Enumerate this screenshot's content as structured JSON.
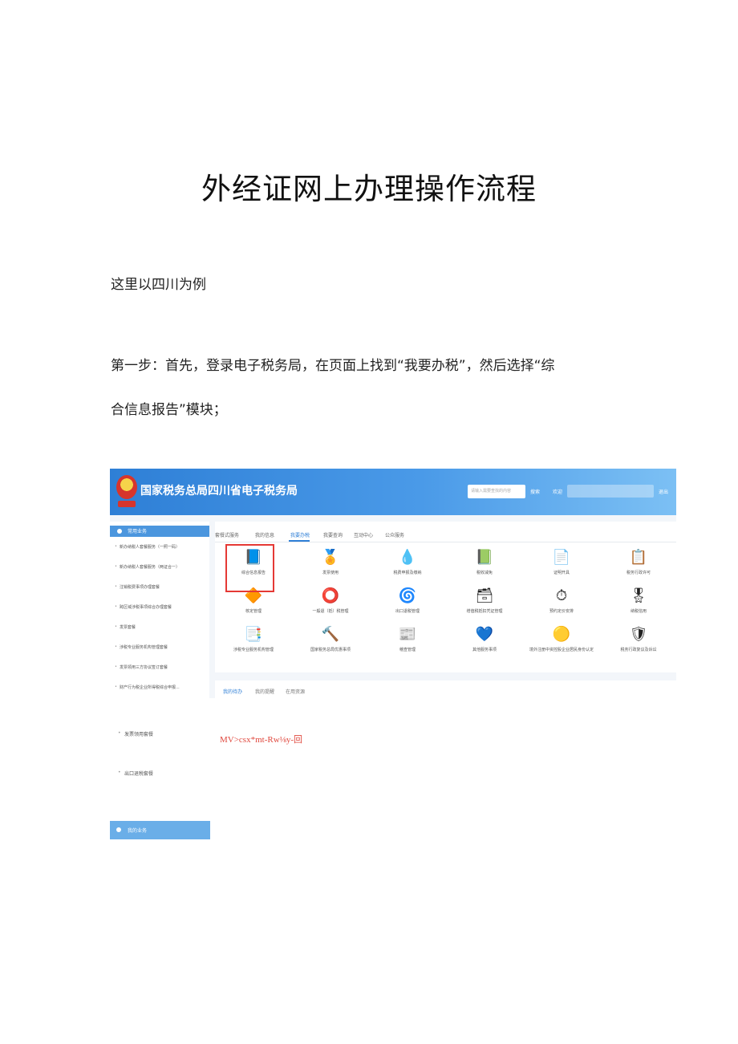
{
  "doc": {
    "title": "外经证网上办理操作流程",
    "intro": "这里以四川为例",
    "step1_line1": "第一步：首先，登录电子税务局，在页面上找到“我要办税”，然后选择“综",
    "step1_line2": "合信息报告”模块；"
  },
  "screenshot": {
    "site_title": "国家税务总局四川省电子税务局",
    "search_placeholder": "请输入需要查找的内容",
    "search_button": "搜索",
    "user_greeting": "欢迎",
    "logout": "退出",
    "sidebar_header": "常用业务",
    "sidebar_items": [
      "新办纳税人套餐服务（一照一码）",
      "新办纳税人套餐服务（两证合一）",
      "注销税费事项办理套餐",
      "跨区域涉税事项综合办理套餐",
      "发票套餐",
      "涉税专业服务机构管理套餐",
      "发票领用三方协议签订套餐",
      "财产行为税企业所得税综合申报..."
    ],
    "tabs": [
      "套餐式服务",
      "我的信息",
      "我要办税",
      "我要查询",
      "互动中心",
      "公众服务"
    ],
    "modules": [
      {
        "label": "综合信息报告",
        "icon": "📘"
      },
      {
        "label": "发票使用",
        "icon": "🏅"
      },
      {
        "label": "税费申报及缴纳",
        "icon": "💧"
      },
      {
        "label": "税收减免",
        "icon": "📗"
      },
      {
        "label": "证明开具",
        "icon": "📄"
      },
      {
        "label": "税务行政许可",
        "icon": "📋"
      },
      {
        "label": "核定管理",
        "icon": "🔶"
      },
      {
        "label": "一般退（抵）税管理",
        "icon": "⭕"
      },
      {
        "label": "出口退税管理",
        "icon": "🌀"
      },
      {
        "label": "增值税抵扣凭证管理",
        "icon": "🗃"
      },
      {
        "label": "预约定价安排",
        "icon": "⏱"
      },
      {
        "label": "纳税信用",
        "icon": "🎖"
      },
      {
        "label": "涉税专业服务机构管理",
        "icon": "📑"
      },
      {
        "label": "国家税务总局优惠事项",
        "icon": "🔨"
      },
      {
        "label": "稽查管理",
        "icon": "📰"
      },
      {
        "label": "其他服务事项",
        "icon": "💙"
      },
      {
        "label": "境外注册中资控股企业居民身份认定",
        "icon": "🟡"
      },
      {
        "label": "税务行政复议及诉讼",
        "icon": "🛡"
      }
    ],
    "lower_tabs": [
      "我的待办",
      "我的提醒",
      "在用资源"
    ]
  },
  "caption": "MV>csx*mt-Rw⅛y-回",
  "orphan_items": [
    "发票领用套餐",
    "出口退税套餐"
  ],
  "my_business": "我的业务"
}
